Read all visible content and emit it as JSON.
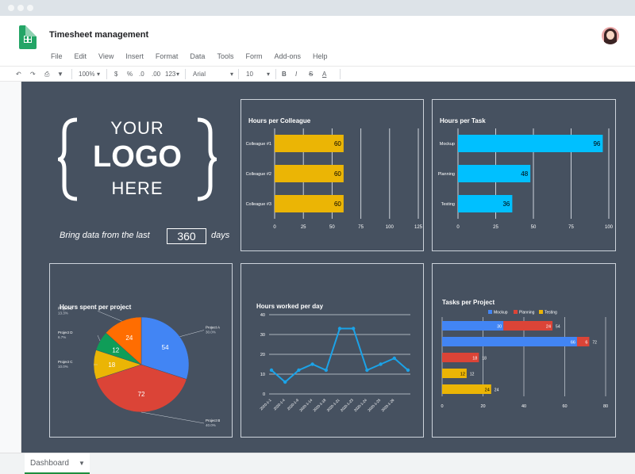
{
  "app": {
    "title": "Timesheet management"
  },
  "menu": [
    "File",
    "Edit",
    "View",
    "Insert",
    "Format",
    "Data",
    "Tools",
    "Form",
    "Add-ons",
    "Help"
  ],
  "toolbar": {
    "zoom": "100%",
    "currency": "$",
    "percent": "%",
    "decimal_less": ".0",
    "decimal_more": ".00",
    "number_format": "123",
    "font": "Arial",
    "size": "10",
    "bold": "B",
    "italic": "I",
    "strike": "S",
    "textcolor": "A"
  },
  "logo": {
    "line1": "YOUR",
    "line2": "LOGO",
    "line3": "HERE"
  },
  "filter": {
    "prefix": "Bring data from the last",
    "value": "360",
    "suffix": "days"
  },
  "sheet_tab": {
    "label": "Dashboard"
  },
  "colors": {
    "background": "#465160",
    "yellow": "#ebb505",
    "cyan": "#00c0ff",
    "blue": "#4285f4",
    "red": "#db4437",
    "green": "#0f9d58",
    "orange": "#ff6d01",
    "line": "#1ba3e8"
  },
  "chart_data": [
    {
      "type": "bar",
      "title": "Hours per Colleague",
      "categories": [
        "Colleague #1",
        "Colleague #2",
        "Colleague #3"
      ],
      "values": [
        60,
        60,
        60
      ],
      "xlim": [
        0,
        125
      ],
      "xticks": [
        "0",
        "25",
        "50",
        "75",
        "100",
        "125"
      ]
    },
    {
      "type": "bar",
      "title": "Hours per Task",
      "categories": [
        "Mockup",
        "Planning",
        "Testing"
      ],
      "values": [
        96,
        48,
        36
      ],
      "xlim": [
        0,
        100
      ],
      "xticks": [
        "0",
        "25",
        "50",
        "75",
        "100"
      ]
    },
    {
      "type": "pie",
      "title": "Hours spent per project",
      "slices": [
        {
          "label": "Project A",
          "value": 54,
          "pct": "30.0%"
        },
        {
          "label": "Project B",
          "value": 72,
          "pct": "40.0%"
        },
        {
          "label": "Project C",
          "value": 18,
          "pct": "10.0%"
        },
        {
          "label": "Project D",
          "value": 12,
          "pct": "6.7%"
        },
        {
          "label": "Project E",
          "value": 24,
          "pct": "13.3%"
        }
      ]
    },
    {
      "type": "line",
      "title": "Hours worked per day",
      "x": [
        "2020-1-1",
        "2020-1-4",
        "2020-1-9",
        "2020-1-14",
        "2020-1-18",
        "2020-1-21",
        "2020-1-23",
        "2020-1-24",
        "2020-1-25",
        "2020-1-26"
      ],
      "values": [
        12,
        6,
        12,
        15,
        12,
        33,
        33,
        12,
        15,
        18,
        12
      ],
      "ylim": [
        0,
        40
      ],
      "yticks": [
        "0",
        "10",
        "20",
        "30",
        "40"
      ]
    },
    {
      "type": "bar",
      "title": "Tasks per Project",
      "legend": [
        "Mockup",
        "Planning",
        "Testing"
      ],
      "rows": [
        {
          "segments": [
            30,
            24
          ],
          "total": "54"
        },
        {
          "segments": [
            66,
            6
          ],
          "total": "72"
        },
        {
          "segments": [
            18
          ],
          "total": "18"
        },
        {
          "segments": [
            12
          ],
          "total": "12"
        },
        {
          "segments": [
            24
          ],
          "total": "24"
        }
      ],
      "xticks": [
        "0",
        "20",
        "40",
        "60",
        "80"
      ],
      "xlim": [
        0,
        80
      ]
    }
  ]
}
